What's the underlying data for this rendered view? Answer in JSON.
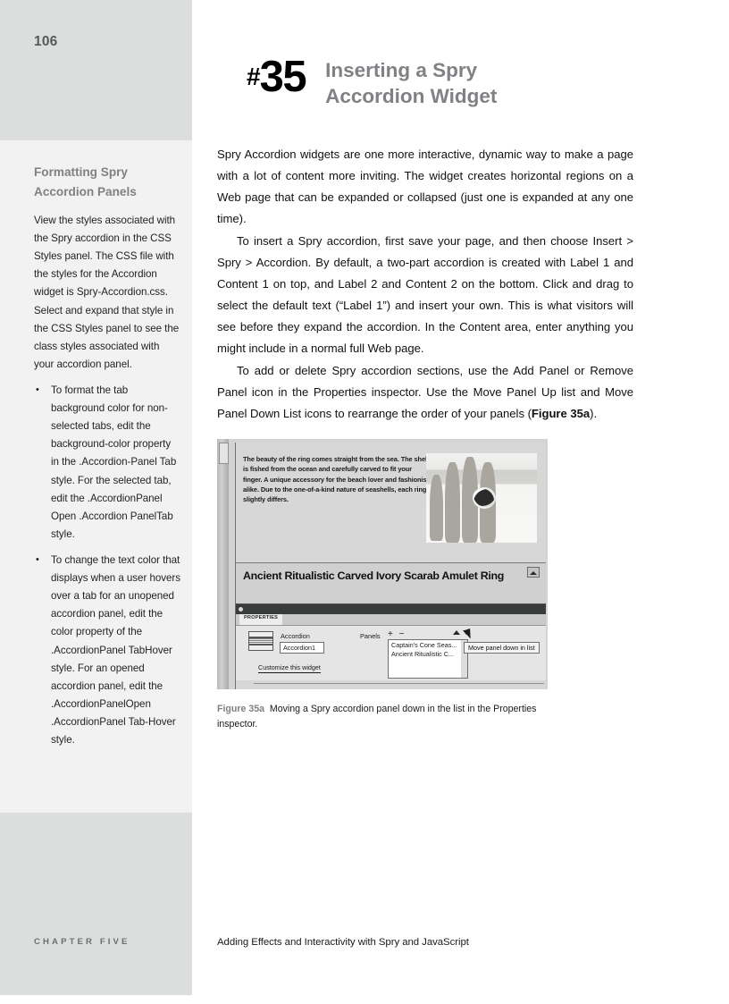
{
  "page": {
    "folio": "106"
  },
  "tip": {
    "hash": "#",
    "number": "35",
    "title_line1": "Inserting a Spry",
    "title_line2": "Accordion Widget"
  },
  "body": {
    "paragraph1": "Spry Accordion widgets are one more interactive, dynamic way to make a page with a lot of content more inviting. The widget creates horizontal regions on a Web page that can be expanded or collapsed (just one is expanded at any one time).",
    "paragraph2": "To insert a Spry accordion, first save your page, and then choose Insert > Spry > Accordion. By default, a two-part accordion is created with Label 1 and Content 1 on top, and Label 2 and Content 2 on the bottom. Click and drag to select the default text (“Label 1”) and insert your own. This is what visitors will see before they expand the accordion. In the Content area, enter anything you might include in a normal full Web page.",
    "paragraph3_a": "To add or delete Spry accordion sections, use the Add Panel or Remove Panel icon in the Properties inspector. Use the Move Panel Up list and Move Panel Down List icons to rearrange the order of your panels (",
    "paragraph3_ref": "Figure 35a",
    "paragraph3_b": ")."
  },
  "sidenote": {
    "heading_line1": "Formatting Spry",
    "heading_line2": "Accordion Panels",
    "paragraph": "View the styles associated with the Spry accordion in the CSS Styles panel. The CSS file with the styles for the Accordion widget is Spry-Accordion.css. Select and expand that style in the CSS Styles panel to see the class styles associated with your accordion panel.",
    "bullet_glyph": "•",
    "bullets": [
      "To format the tab background color for non-selected tabs, edit the background-color property in the .Accordion-Panel Tab style. For the selected tab, edit the .AccordionPanel Open .Accordion PanelTab style.",
      "To change the text color that displays when a user hovers over a tab for an unopened accordion panel, edit the color property of the .AccordionPanel TabHover style. For an opened accordion panel, edit the .AccordionPanelOpen .AccordionPanel Tab-Hover style."
    ]
  },
  "figure": {
    "caption_label": "Figure 35a",
    "caption_text": "Moving a Spry accordion panel down in the list in the Properties inspector.",
    "screenshot": {
      "panel_content": "The beauty of the ring comes straight from the sea. The shell is fished from the ocean and carefully carved to fit your finger. A unique accessory for the beach lover and fashionista alike. Due to the one-of-a-kind nature of seashells, each ring slightly differs.",
      "panel_tab_title": "Ancient Ritualistic Carved Ivory Scarab Amulet Ring",
      "properties_tab": "PROPERTIES",
      "widget_type": "Accordion",
      "widget_id": "Accordion1",
      "customize_link": "Customize this widget",
      "panels_label": "Panels",
      "panels_addremove": "+ −",
      "panel_items": [
        "Captain's Cone Seas...",
        "Ancient Ritualistic C..."
      ],
      "tooltip": "Move panel down in list"
    }
  },
  "footer": {
    "chapter": "CHAPTER FIVE",
    "running_head": "Adding Effects and Interactivity with Spry and JavaScript"
  },
  "colors": {
    "margin_gray": "#dcdedd",
    "sidenote_gray": "#f1f2f1",
    "heading_gray": "#808184",
    "body_black": "#111111"
  }
}
